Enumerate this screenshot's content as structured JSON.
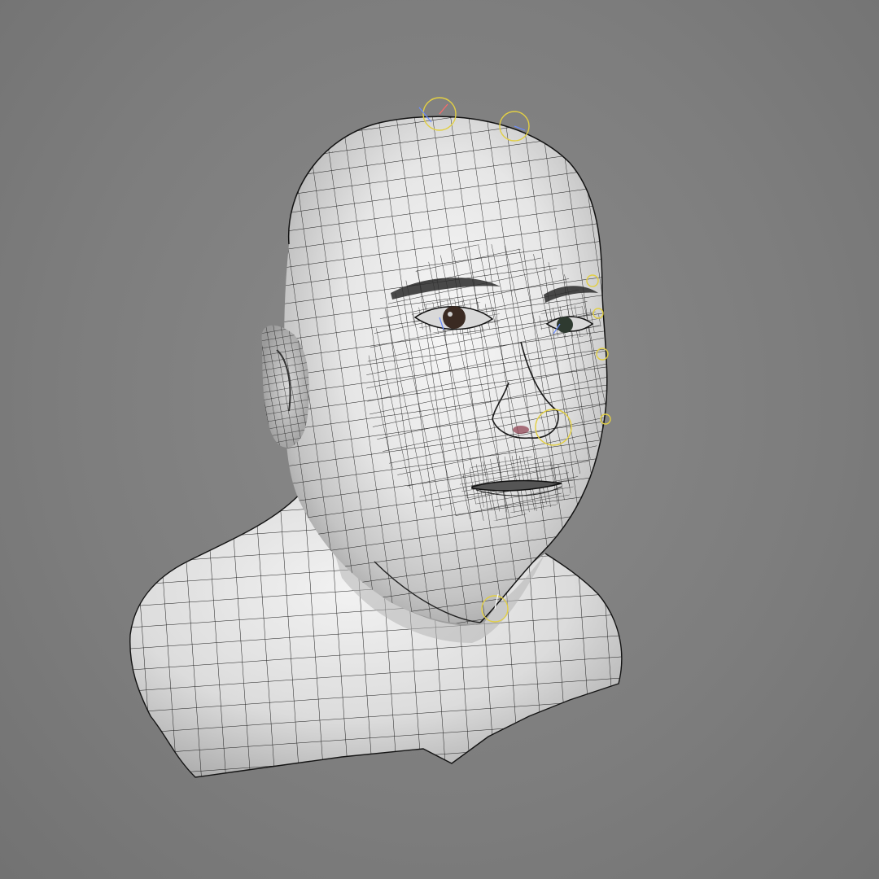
{
  "viewport": {
    "shading_mode": "smooth-shaded-with-wireframe-on-shaded",
    "background_color": "#7d7d7d",
    "model": "head-bust",
    "wire_color": "#1a1a1a",
    "surface_light": "#f4f4f4",
    "surface_shadow": "#9c9c9c",
    "rig_handle_color": "#e8d24a"
  }
}
